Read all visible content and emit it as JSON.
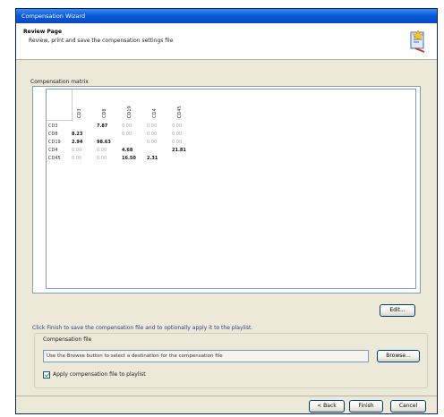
{
  "window": {
    "title": "Compensation Wizard"
  },
  "header": {
    "title": "Review Page",
    "subtitle": "Review, print and save the compensation settings file"
  },
  "matrix": {
    "label": "Compensation matrix",
    "columns": [
      "CD3",
      "CD8",
      "CD19",
      "CD4",
      "CD45"
    ],
    "rows": [
      {
        "name": "CD3",
        "cells": [
          {
            "v": "",
            "s": "dim"
          },
          {
            "v": "7.87",
            "s": "bold"
          },
          {
            "v": "0.00",
            "s": "dim"
          },
          {
            "v": "0.00",
            "s": "dim"
          },
          {
            "v": "0.00",
            "s": "dim"
          }
        ]
      },
      {
        "name": "CD8",
        "cells": [
          {
            "v": "8.23",
            "s": "bold"
          },
          {
            "v": "",
            "s": "dim"
          },
          {
            "v": "0.00",
            "s": "dim"
          },
          {
            "v": "0.00",
            "s": "dim"
          },
          {
            "v": "0.00",
            "s": "dim"
          }
        ]
      },
      {
        "name": "CD19",
        "cells": [
          {
            "v": "2.94",
            "s": "bold"
          },
          {
            "v": "98.63",
            "s": "bold"
          },
          {
            "v": "",
            "s": "dim"
          },
          {
            "v": "0.00",
            "s": "dim"
          },
          {
            "v": "0.00",
            "s": "dim"
          }
        ]
      },
      {
        "name": "CD4",
        "cells": [
          {
            "v": "0.00",
            "s": "dim"
          },
          {
            "v": "0.00",
            "s": "dim"
          },
          {
            "v": "4.68",
            "s": "bold"
          },
          {
            "v": "",
            "s": "dim"
          },
          {
            "v": "21.81",
            "s": "bold"
          }
        ]
      },
      {
        "name": "CD45",
        "cells": [
          {
            "v": "0.00",
            "s": "dim"
          },
          {
            "v": "0.00",
            "s": "dim"
          },
          {
            "v": "16.50",
            "s": "bold"
          },
          {
            "v": "2.31",
            "s": "bold"
          },
          {
            "v": "",
            "s": "dim"
          }
        ]
      }
    ]
  },
  "buttons": {
    "edit": "Edit...",
    "browse": "Browse...",
    "back": "< Back",
    "finish": "Finish",
    "cancel": "Cancel"
  },
  "hint": "Click Finish to save the compensation file and to optionally apply it to the playlist.",
  "file_group": {
    "label": "Compensation file",
    "placeholder": "Use the Browse button to select a destination for the compensation file"
  },
  "apply_checkbox": {
    "label": "Apply compensation file to playlist",
    "checked": true
  },
  "colors": {
    "title_bar": "#0a5bd9",
    "window_bg": "#ece9d8",
    "border": "#7f9db9"
  }
}
